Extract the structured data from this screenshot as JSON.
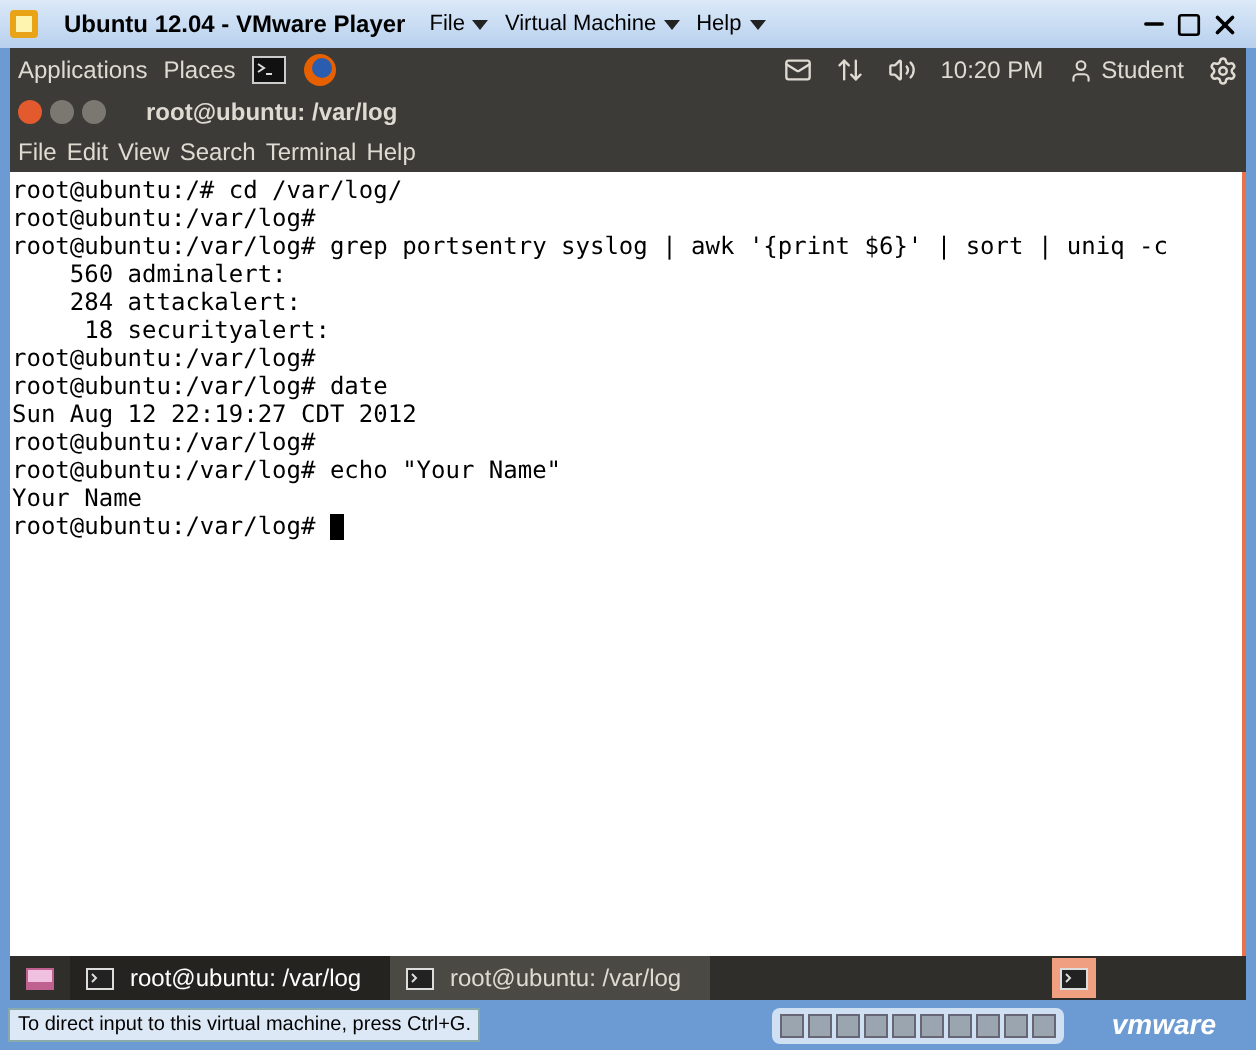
{
  "window": {
    "title": "Ubuntu 12.04 - VMware Player",
    "menu": [
      "File",
      "Virtual Machine",
      "Help"
    ]
  },
  "top_panel": {
    "menus": [
      "Applications",
      "Places"
    ],
    "clock": "10:20 PM",
    "user": "Student"
  },
  "terminal": {
    "title": "root@ubuntu: /var/log",
    "menu": [
      "File",
      "Edit",
      "View",
      "Search",
      "Terminal",
      "Help"
    ],
    "lines": [
      "root@ubuntu:/# cd /var/log/",
      "root@ubuntu:/var/log#",
      "root@ubuntu:/var/log# grep portsentry syslog | awk '{print $6}' | sort | uniq -c",
      "    560 adminalert:",
      "    284 attackalert:",
      "     18 securityalert:",
      "root@ubuntu:/var/log#",
      "root@ubuntu:/var/log# date",
      "Sun Aug 12 22:19:27 CDT 2012",
      "root@ubuntu:/var/log#",
      "root@ubuntu:/var/log# echo \"Your Name\"",
      "Your Name",
      "root@ubuntu:/var/log# "
    ]
  },
  "taskbar": [
    {
      "label": "root@ubuntu: /var/log",
      "selected": true
    },
    {
      "label": "root@ubuntu: /var/log",
      "selected": false
    }
  ],
  "status_bar": {
    "text": "To direct input to this virtual machine, press Ctrl+G.",
    "brand": "vmware"
  }
}
